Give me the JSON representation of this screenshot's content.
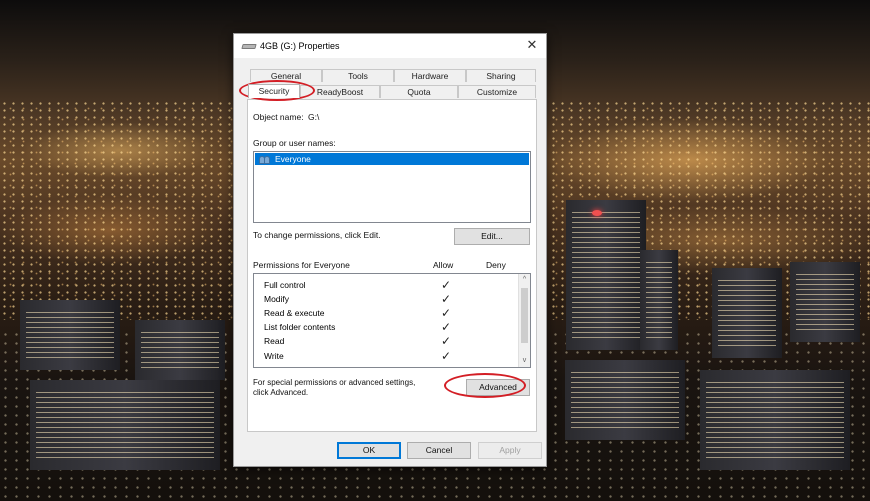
{
  "dialog": {
    "title": "4GB (G:) Properties",
    "close_glyph": "✕",
    "tabs_row1": [
      "General",
      "Tools",
      "Hardware",
      "Sharing"
    ],
    "tabs_row2": [
      "Security",
      "ReadyBoost",
      "Quota",
      "Customize"
    ],
    "active_tab": "Security"
  },
  "security": {
    "object_name_label": "Object name:",
    "object_name_value": "G:\\",
    "group_label": "Group or user names:",
    "groups": [
      "Everyone"
    ],
    "selected_group": "Everyone",
    "change_hint": "To change permissions, click Edit.",
    "edit_button": "Edit...",
    "permissions_header": "Permissions for Everyone",
    "allow_header": "Allow",
    "deny_header": "Deny",
    "permissions": [
      {
        "name": "Full control",
        "allow": "✓",
        "deny": ""
      },
      {
        "name": "Modify",
        "allow": "✓",
        "deny": ""
      },
      {
        "name": "Read & execute",
        "allow": "✓",
        "deny": ""
      },
      {
        "name": "List folder contents",
        "allow": "✓",
        "deny": ""
      },
      {
        "name": "Read",
        "allow": "✓",
        "deny": ""
      },
      {
        "name": "Write",
        "allow": "✓",
        "deny": ""
      }
    ],
    "scroll_up_glyph": "^",
    "scroll_down_glyph": "v",
    "advanced_hint_line1": "For special permissions or advanced settings,",
    "advanced_hint_line2": "click Advanced.",
    "advanced_button": "Advanced"
  },
  "footer": {
    "ok": "OK",
    "cancel": "Cancel",
    "apply": "Apply"
  },
  "colors": {
    "selection": "#0078d7",
    "annotation": "#d31e25"
  },
  "icons": {
    "title": "drive-icon",
    "close": "close-icon",
    "group": "users-icon",
    "check": "checkmark-icon"
  }
}
